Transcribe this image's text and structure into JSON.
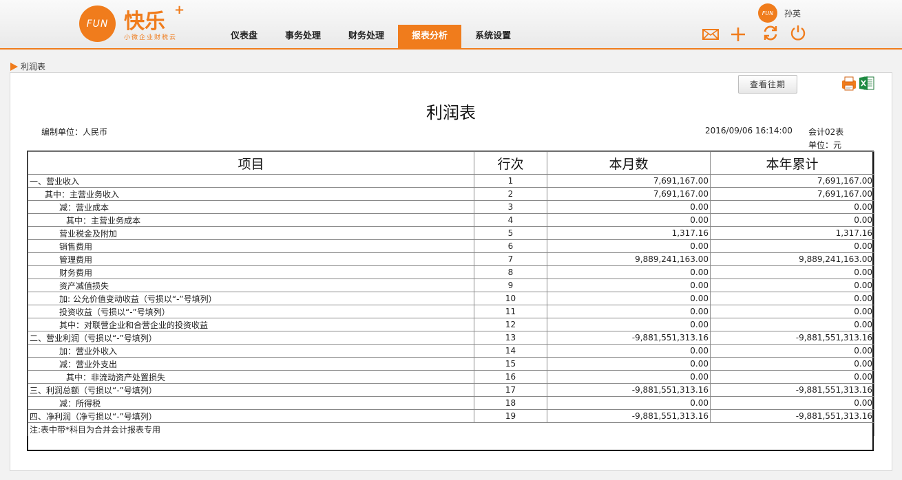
{
  "header": {
    "logo_mark": "FUN",
    "logo_name": "快乐",
    "logo_plus": "+",
    "logo_tagline": "小微企业财税云",
    "nav": [
      {
        "label": "仪表盘",
        "active": false
      },
      {
        "label": "事务处理",
        "active": false
      },
      {
        "label": "财务处理",
        "active": false
      },
      {
        "label": "报表分析",
        "active": true
      },
      {
        "label": "系统设置",
        "active": false
      }
    ],
    "user_name": "孙英",
    "icons": [
      "mail-icon",
      "plus-icon",
      "refresh-icon",
      "power-icon"
    ],
    "accent": "#f07c1c"
  },
  "breadcrumb": "利润表",
  "toolbar": {
    "history_button": "查看往期",
    "export_icons": [
      "print-icon",
      "excel-icon"
    ]
  },
  "report": {
    "title": "利润表",
    "unit_org": "编制单位：人民币",
    "datetime": "2016/09/06 16:14:00",
    "form_code": "会计02表",
    "currency_unit": "单位：元",
    "columns": [
      "项目",
      "行次",
      "本月数",
      "本年累计"
    ],
    "rows": [
      {
        "item": "一、营业收入",
        "level": 0,
        "line": "1",
        "month": "7,691,167.00",
        "year": "7,691,167.00"
      },
      {
        "item": "其中：主营业务收入",
        "level": 1,
        "line": "2",
        "month": "7,691,167.00",
        "year": "7,691,167.00"
      },
      {
        "item": "减：营业成本",
        "level": 2,
        "line": "3",
        "month": "0.00",
        "year": "0.00"
      },
      {
        "item": "其中：主营业务成本",
        "level": 3,
        "line": "4",
        "month": "0.00",
        "year": "0.00"
      },
      {
        "item": "营业税金及附加",
        "level": 2,
        "line": "5",
        "month": "1,317.16",
        "year": "1,317.16"
      },
      {
        "item": "销售费用",
        "level": 2,
        "line": "6",
        "month": "0.00",
        "year": "0.00"
      },
      {
        "item": "管理费用",
        "level": 2,
        "line": "7",
        "month": "9,889,241,163.00",
        "year": "9,889,241,163.00"
      },
      {
        "item": "财务费用",
        "level": 2,
        "line": "8",
        "month": "0.00",
        "year": "0.00"
      },
      {
        "item": "资产减值损失",
        "level": 2,
        "line": "9",
        "month": "0.00",
        "year": "0.00"
      },
      {
        "item": "加: 公允价值变动收益（亏损以“-”号填列）",
        "level": 2,
        "line": "10",
        "month": "0.00",
        "year": "0.00"
      },
      {
        "item": "投资收益（亏损以“-”号填列）",
        "level": 2,
        "line": "11",
        "month": "0.00",
        "year": "0.00"
      },
      {
        "item": "其中：对联营企业和合营企业的投资收益",
        "level": 2,
        "line": "12",
        "month": "0.00",
        "year": "0.00"
      },
      {
        "item": "二、营业利润（亏损以“-”号填列）",
        "level": 0,
        "line": "13",
        "month": "-9,881,551,313.16",
        "year": "-9,881,551,313.16"
      },
      {
        "item": "加：营业外收入",
        "level": 2,
        "line": "14",
        "month": "0.00",
        "year": "0.00"
      },
      {
        "item": "减：营业外支出",
        "level": 2,
        "line": "15",
        "month": "0.00",
        "year": "0.00"
      },
      {
        "item": "其中：非流动资产处置损失",
        "level": 3,
        "line": "16",
        "month": "0.00",
        "year": "0.00"
      },
      {
        "item": "三、利润总额（亏损以“-”号填列）",
        "level": 0,
        "line": "17",
        "month": "-9,881,551,313.16",
        "year": "-9,881,551,313.16"
      },
      {
        "item": "减：所得税",
        "level": 2,
        "line": "18",
        "month": "0.00",
        "year": "0.00"
      },
      {
        "item": "四、净利润（净亏损以“-”号填列）",
        "level": 0,
        "line": "19",
        "month": "-9,881,551,313.16",
        "year": "-9,881,551,313.16"
      }
    ],
    "note": "注:表中带*科目为合并会计报表专用"
  }
}
